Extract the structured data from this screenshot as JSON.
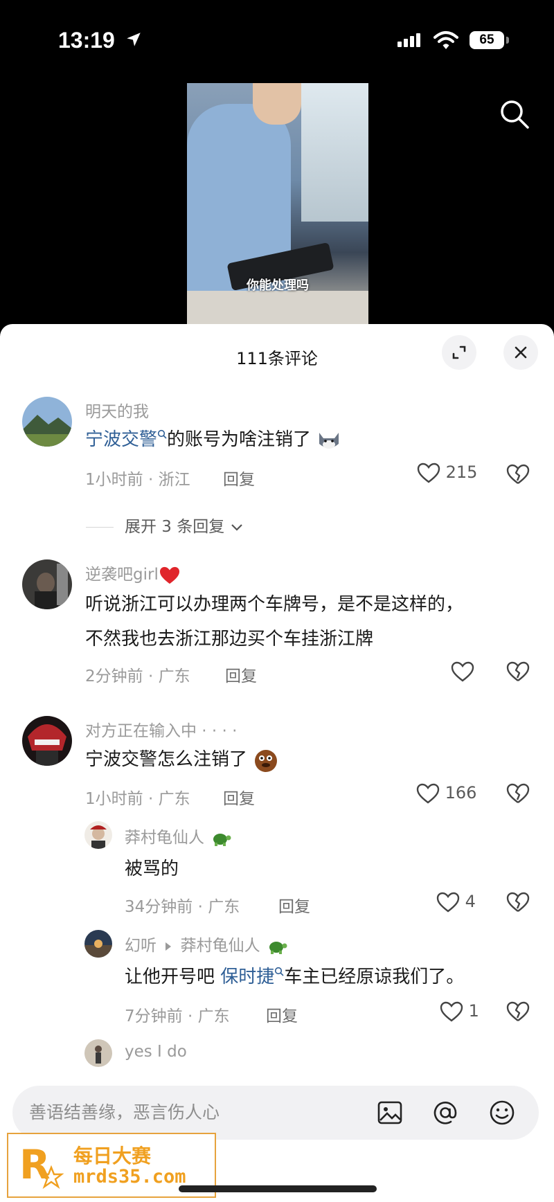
{
  "status_bar": {
    "time": "13:19",
    "battery": "65"
  },
  "video": {
    "caption": "你能处理吗"
  },
  "sheet": {
    "title": "111条评论"
  },
  "comments": [
    {
      "username": "明天的我",
      "text_link": "宁波交警",
      "text_rest": "的账号为啥注销了",
      "meta": "1小时前 · 浙江",
      "reply_label": "回复",
      "likes": "215",
      "expand_label": "展开 3 条回复"
    },
    {
      "username": "逆袭吧girl",
      "text_line1": "听说浙江可以办理两个车牌号，是不是这样的，",
      "text_line2": "不然我也去浙江那边买个车挂浙江牌",
      "meta": "2分钟前 · 广东",
      "reply_label": "回复"
    },
    {
      "username": "对方正在输入中 · · · ·",
      "text": "宁波交警怎么注销了",
      "meta": "1小时前 · 广东",
      "reply_label": "回复",
      "likes": "166",
      "replies": [
        {
          "username": "莽村龟仙人",
          "text": "被骂的",
          "meta": "34分钟前 · 广东",
          "reply_label": "回复",
          "likes": "4"
        },
        {
          "username": "幻听",
          "reply_to": "莽村龟仙人",
          "text_pre": "让他开号吧 ",
          "text_link": "保时捷",
          "text_post": "车主已经原谅我们了。",
          "meta": "7分钟前 · 广东",
          "reply_label": "回复",
          "likes": "1"
        },
        {
          "username": "yes I do"
        }
      ]
    }
  ],
  "input": {
    "placeholder": "善语结善缘，恶言伤人心"
  },
  "watermark": {
    "line1": "每日大赛",
    "line2": "mrds35.com"
  },
  "colors": {
    "link": "#2f5f96",
    "heart_red": "#e0252b",
    "watermark": "#f0a020"
  }
}
